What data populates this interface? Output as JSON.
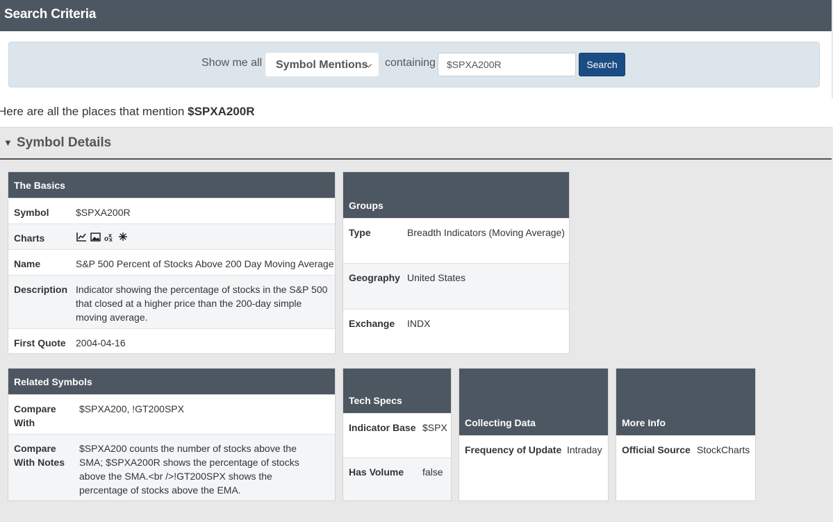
{
  "header": {
    "title": "Search Criteria"
  },
  "search": {
    "show_label": "Show me all",
    "type_selected": "Symbol Mentions",
    "containing_label": "containing",
    "query_value": "$SPXA200R",
    "button_label": "Search"
  },
  "mention": {
    "prefix": "Here are all the places that mention",
    "symbol": "$SPXA200R"
  },
  "details": {
    "title": "Symbol Details"
  },
  "basics": {
    "title": "The Basics",
    "rows": [
      {
        "key": "Symbol",
        "value": "$SPXA200R"
      },
      {
        "key": "Charts",
        "value": ""
      },
      {
        "key": "Name",
        "value": "S&P 500 Percent of Stocks Above 200 Day Moving Average"
      },
      {
        "key": "Description",
        "value": "Indicator showing the percentage of stocks in the S&P 500 that closed at a higher price than the 200-day simple moving average."
      },
      {
        "key": "First Quote",
        "value": "2004-04-16"
      }
    ],
    "chart_icons": [
      "line-chart-icon",
      "image-chart-icon",
      "point-figure-icon",
      "snowflake-icon"
    ]
  },
  "groups": {
    "title": "Groups",
    "rows": [
      {
        "key": "Type",
        "value": "Breadth Indicators (Moving Average)"
      },
      {
        "key": "Geography",
        "value": "United States"
      },
      {
        "key": "Exchange",
        "value": "INDX"
      }
    ]
  },
  "related": {
    "title": "Related Symbols",
    "rows": [
      {
        "key": "Compare With",
        "value": "$SPXA200, !GT200SPX"
      },
      {
        "key": "Compare With Notes",
        "value": "$SPXA200 counts the number of stocks above the SMA; $SPXA200R shows the percentage of stocks above the SMA.<br />!GT200SPX shows the percentage of stocks above the EMA."
      }
    ]
  },
  "tech": {
    "title": "Tech Specs",
    "rows": [
      {
        "key": "Indicator Base",
        "value": "$SPX"
      },
      {
        "key": "Has Volume",
        "value": "false"
      }
    ]
  },
  "collecting": {
    "title": "Collecting Data",
    "rows": [
      {
        "key": "Frequency of Update",
        "value": "Intraday"
      }
    ]
  },
  "more": {
    "title": "More Info",
    "rows": [
      {
        "key": "Official Source",
        "value": "StockCharts"
      }
    ]
  }
}
